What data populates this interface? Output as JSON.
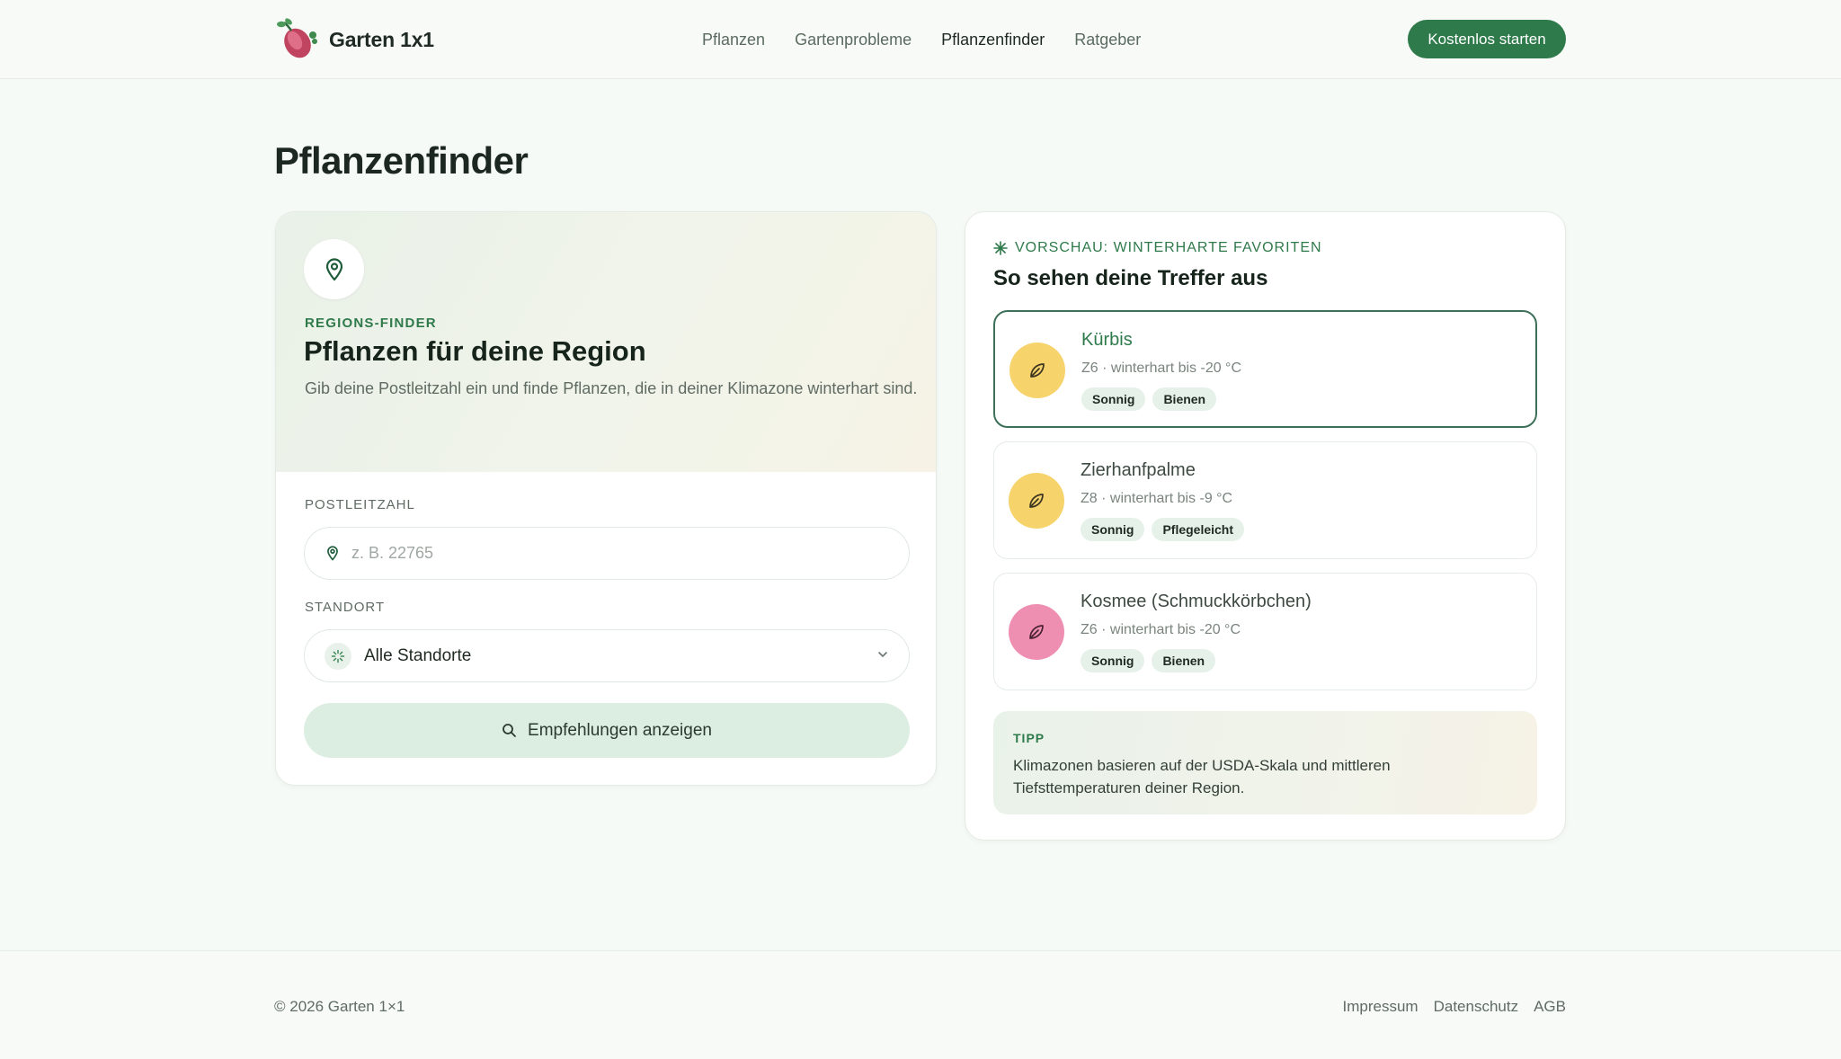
{
  "header": {
    "brand": "Garten 1x1",
    "nav": [
      "Pflanzen",
      "Gartenprobleme",
      "Pflanzenfinder",
      "Ratgeber"
    ],
    "active_nav": "Pflanzenfinder",
    "cta": "Kostenlos starten"
  },
  "page": {
    "title": "Pflanzenfinder"
  },
  "finder": {
    "eyebrow": "REGIONS-FINDER",
    "title": "Pflanzen für deine Region",
    "description": "Gib deine Postleitzahl ein und finde Pflanzen, die in deiner Klimazone winterhart sind.",
    "zip_label": "POSTLEITZAHL",
    "zip_placeholder": "z. B. 22765",
    "zip_value": "",
    "location_label": "STANDORT",
    "location_value": "Alle Standorte",
    "submit_label": "Empfehlungen anzeigen"
  },
  "preview": {
    "eyebrow": "VORSCHAU: WINTERHARTE FAVORITEN",
    "title": "So sehen deine Treffer aus",
    "plants": [
      {
        "name": "Kürbis",
        "meta": "Z6 · winterhart bis -20 °C",
        "tags": [
          "Sonnig",
          "Bienen"
        ],
        "icon_color": "#f6d36b",
        "selected": true
      },
      {
        "name": "Zierhanfpalme",
        "meta": "Z8 · winterhart bis -9 °C",
        "tags": [
          "Sonnig",
          "Pflegeleicht"
        ],
        "icon_color": "#f6d36b",
        "selected": false
      },
      {
        "name": "Kosmee (Schmuckkörbchen)",
        "meta": "Z6 · winterhart bis -20 °C",
        "tags": [
          "Sonnig",
          "Bienen"
        ],
        "icon_color": "#ee8fb1",
        "selected": false
      }
    ],
    "tip_label": "TIPP",
    "tip_text": "Klimazonen basieren auf der USDA-Skala und mittleren Tiefsttemperaturen deiner Region."
  },
  "footer": {
    "copyright": "© 2026 Garten 1×1",
    "links": [
      "Impressum",
      "Datenschutz",
      "AGB"
    ]
  },
  "colors": {
    "brand_green": "#2f7a4b",
    "background": "#f6faf6"
  }
}
